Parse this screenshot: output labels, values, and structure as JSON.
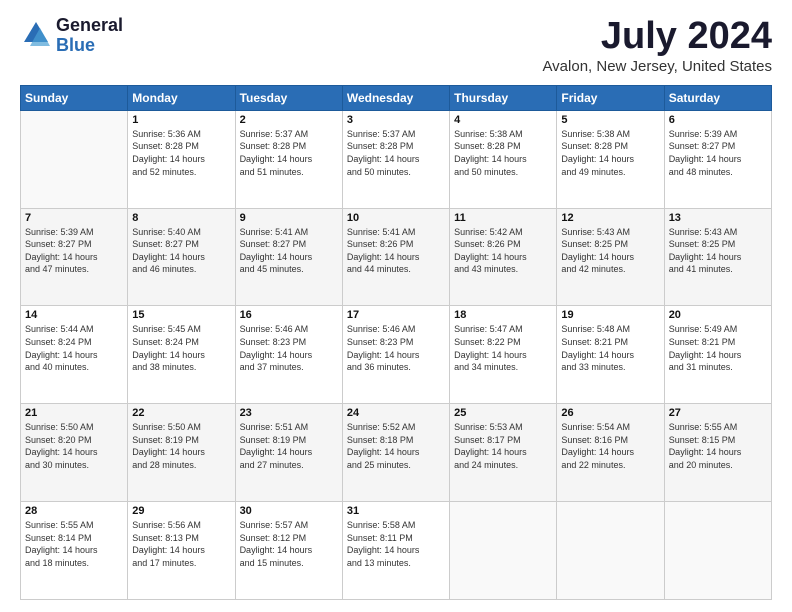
{
  "logo": {
    "general": "General",
    "blue": "Blue"
  },
  "title": "July 2024",
  "subtitle": "Avalon, New Jersey, United States",
  "header_days": [
    "Sunday",
    "Monday",
    "Tuesday",
    "Wednesday",
    "Thursday",
    "Friday",
    "Saturday"
  ],
  "weeks": [
    [
      {
        "day": "",
        "info": ""
      },
      {
        "day": "1",
        "info": "Sunrise: 5:36 AM\nSunset: 8:28 PM\nDaylight: 14 hours\nand 52 minutes."
      },
      {
        "day": "2",
        "info": "Sunrise: 5:37 AM\nSunset: 8:28 PM\nDaylight: 14 hours\nand 51 minutes."
      },
      {
        "day": "3",
        "info": "Sunrise: 5:37 AM\nSunset: 8:28 PM\nDaylight: 14 hours\nand 50 minutes."
      },
      {
        "day": "4",
        "info": "Sunrise: 5:38 AM\nSunset: 8:28 PM\nDaylight: 14 hours\nand 50 minutes."
      },
      {
        "day": "5",
        "info": "Sunrise: 5:38 AM\nSunset: 8:28 PM\nDaylight: 14 hours\nand 49 minutes."
      },
      {
        "day": "6",
        "info": "Sunrise: 5:39 AM\nSunset: 8:27 PM\nDaylight: 14 hours\nand 48 minutes."
      }
    ],
    [
      {
        "day": "7",
        "info": "Sunrise: 5:39 AM\nSunset: 8:27 PM\nDaylight: 14 hours\nand 47 minutes."
      },
      {
        "day": "8",
        "info": "Sunrise: 5:40 AM\nSunset: 8:27 PM\nDaylight: 14 hours\nand 46 minutes."
      },
      {
        "day": "9",
        "info": "Sunrise: 5:41 AM\nSunset: 8:27 PM\nDaylight: 14 hours\nand 45 minutes."
      },
      {
        "day": "10",
        "info": "Sunrise: 5:41 AM\nSunset: 8:26 PM\nDaylight: 14 hours\nand 44 minutes."
      },
      {
        "day": "11",
        "info": "Sunrise: 5:42 AM\nSunset: 8:26 PM\nDaylight: 14 hours\nand 43 minutes."
      },
      {
        "day": "12",
        "info": "Sunrise: 5:43 AM\nSunset: 8:25 PM\nDaylight: 14 hours\nand 42 minutes."
      },
      {
        "day": "13",
        "info": "Sunrise: 5:43 AM\nSunset: 8:25 PM\nDaylight: 14 hours\nand 41 minutes."
      }
    ],
    [
      {
        "day": "14",
        "info": "Sunrise: 5:44 AM\nSunset: 8:24 PM\nDaylight: 14 hours\nand 40 minutes."
      },
      {
        "day": "15",
        "info": "Sunrise: 5:45 AM\nSunset: 8:24 PM\nDaylight: 14 hours\nand 38 minutes."
      },
      {
        "day": "16",
        "info": "Sunrise: 5:46 AM\nSunset: 8:23 PM\nDaylight: 14 hours\nand 37 minutes."
      },
      {
        "day": "17",
        "info": "Sunrise: 5:46 AM\nSunset: 8:23 PM\nDaylight: 14 hours\nand 36 minutes."
      },
      {
        "day": "18",
        "info": "Sunrise: 5:47 AM\nSunset: 8:22 PM\nDaylight: 14 hours\nand 34 minutes."
      },
      {
        "day": "19",
        "info": "Sunrise: 5:48 AM\nSunset: 8:21 PM\nDaylight: 14 hours\nand 33 minutes."
      },
      {
        "day": "20",
        "info": "Sunrise: 5:49 AM\nSunset: 8:21 PM\nDaylight: 14 hours\nand 31 minutes."
      }
    ],
    [
      {
        "day": "21",
        "info": "Sunrise: 5:50 AM\nSunset: 8:20 PM\nDaylight: 14 hours\nand 30 minutes."
      },
      {
        "day": "22",
        "info": "Sunrise: 5:50 AM\nSunset: 8:19 PM\nDaylight: 14 hours\nand 28 minutes."
      },
      {
        "day": "23",
        "info": "Sunrise: 5:51 AM\nSunset: 8:19 PM\nDaylight: 14 hours\nand 27 minutes."
      },
      {
        "day": "24",
        "info": "Sunrise: 5:52 AM\nSunset: 8:18 PM\nDaylight: 14 hours\nand 25 minutes."
      },
      {
        "day": "25",
        "info": "Sunrise: 5:53 AM\nSunset: 8:17 PM\nDaylight: 14 hours\nand 24 minutes."
      },
      {
        "day": "26",
        "info": "Sunrise: 5:54 AM\nSunset: 8:16 PM\nDaylight: 14 hours\nand 22 minutes."
      },
      {
        "day": "27",
        "info": "Sunrise: 5:55 AM\nSunset: 8:15 PM\nDaylight: 14 hours\nand 20 minutes."
      }
    ],
    [
      {
        "day": "28",
        "info": "Sunrise: 5:55 AM\nSunset: 8:14 PM\nDaylight: 14 hours\nand 18 minutes."
      },
      {
        "day": "29",
        "info": "Sunrise: 5:56 AM\nSunset: 8:13 PM\nDaylight: 14 hours\nand 17 minutes."
      },
      {
        "day": "30",
        "info": "Sunrise: 5:57 AM\nSunset: 8:12 PM\nDaylight: 14 hours\nand 15 minutes."
      },
      {
        "day": "31",
        "info": "Sunrise: 5:58 AM\nSunset: 8:11 PM\nDaylight: 14 hours\nand 13 minutes."
      },
      {
        "day": "",
        "info": ""
      },
      {
        "day": "",
        "info": ""
      },
      {
        "day": "",
        "info": ""
      }
    ]
  ]
}
